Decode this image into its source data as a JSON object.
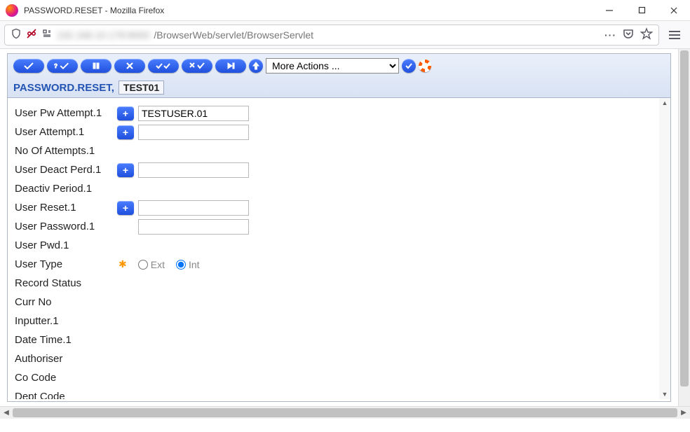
{
  "window": {
    "title": "PASSWORD.RESET - Mozilla Firefox"
  },
  "urlbar": {
    "hidden_prefix": "192.168.10.178:8000",
    "path": "/BrowserWeb/servlet/BrowserServlet",
    "more_dots": "···"
  },
  "toolbar": {
    "more_actions_label": "More Actions ..."
  },
  "breadcrumb": {
    "title": "PASSWORD.RESET,",
    "record_id": "TEST01"
  },
  "form": {
    "rows": [
      {
        "label": "User Pw Attempt.1",
        "has_plus": true,
        "has_input": true,
        "value": "TESTUSER.01"
      },
      {
        "label": "User Attempt.1",
        "has_plus": true,
        "has_input": true,
        "value": ""
      },
      {
        "label": "No Of Attempts.1",
        "has_plus": false,
        "has_input": false
      },
      {
        "label": "User Deact Perd.1",
        "has_plus": true,
        "has_input": true,
        "value": ""
      },
      {
        "label": "Deactiv Period.1",
        "has_plus": false,
        "has_input": false
      },
      {
        "label": "User Reset.1",
        "has_plus": true,
        "has_input": true,
        "value": ""
      },
      {
        "label": "User Password.1",
        "has_plus": false,
        "has_input": true,
        "value": ""
      },
      {
        "label": "User Pwd.1",
        "has_plus": false,
        "has_input": false
      },
      {
        "label": "User Type",
        "has_plus": false,
        "has_input": false,
        "is_radio": true
      },
      {
        "label": "Record Status",
        "has_plus": false,
        "has_input": false
      },
      {
        "label": "Curr No",
        "has_plus": false,
        "has_input": false
      },
      {
        "label": "Inputter.1",
        "has_plus": false,
        "has_input": false
      },
      {
        "label": "Date Time.1",
        "has_plus": false,
        "has_input": false
      },
      {
        "label": "Authoriser",
        "has_plus": false,
        "has_input": false
      },
      {
        "label": "Co Code",
        "has_plus": false,
        "has_input": false
      },
      {
        "label": "Dept Code",
        "has_plus": false,
        "has_input": false
      }
    ],
    "user_type": {
      "required": true,
      "options": [
        {
          "label": "Ext",
          "checked": false
        },
        {
          "label": "Int",
          "checked": true
        }
      ]
    }
  }
}
